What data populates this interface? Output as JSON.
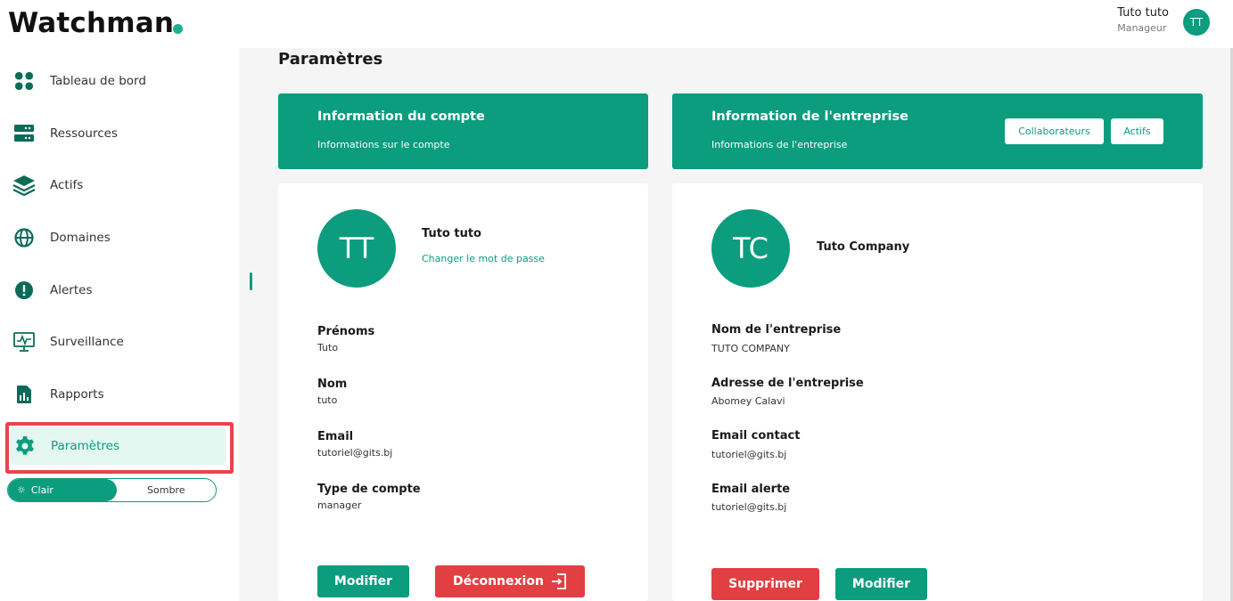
{
  "app": {
    "name": "Watchman"
  },
  "user": {
    "name": "Tuto tuto",
    "role": "Manageur",
    "initials": "TT"
  },
  "sidebar": {
    "items": [
      {
        "label": "Tableau de bord",
        "icon": "dashboard-grid-icon"
      },
      {
        "label": "Ressources",
        "icon": "server-icon"
      },
      {
        "label": "Actifs",
        "icon": "layers-icon"
      },
      {
        "label": "Domaines",
        "icon": "globe-icon"
      },
      {
        "label": "Alertes",
        "icon": "alert-icon"
      },
      {
        "label": "Surveillance",
        "icon": "monitor-icon"
      },
      {
        "label": "Rapports",
        "icon": "report-chart-icon"
      },
      {
        "label": "Paramètres",
        "icon": "gear-icon",
        "active": true
      }
    ],
    "theme": {
      "light": "Clair",
      "dark": "Sombre",
      "selected": "Clair"
    }
  },
  "page": {
    "title": "Paramètres"
  },
  "account": {
    "banner_title": "Information du compte",
    "banner_subtitle": "Informations sur le compte",
    "initials": "TT",
    "name": "Tuto tuto",
    "change_password": "Changer le mot de passe",
    "fields": [
      {
        "label": "Prénoms",
        "value": "Tuto"
      },
      {
        "label": "Nom",
        "value": "tuto"
      },
      {
        "label": "Email",
        "value": "tutoriel@gits.bj"
      },
      {
        "label": "Type de compte",
        "value": "manager"
      }
    ],
    "modify_label": "Modifier",
    "logout_label": "Déconnexion"
  },
  "company": {
    "banner_title": "Information de l'entreprise",
    "banner_subtitle": "Informations de l'entreprise",
    "collaborators_label": "Collaborateurs",
    "assets_label": "Actifs",
    "initials": "TC",
    "name": "Tuto Company",
    "fields": [
      {
        "label": "Nom de l'entreprise",
        "value": "TUTO COMPANY"
      },
      {
        "label": "Adresse de l'entreprise",
        "value": "Abomey Calavi"
      },
      {
        "label": "Email contact",
        "value": "tutoriel@gits.bj"
      },
      {
        "label": "Email alerte",
        "value": "tutoriel@gits.bj"
      }
    ],
    "delete_label": "Supprimer",
    "modify_label": "Modifier"
  },
  "colors": {
    "accent": "#0c9c7e",
    "danger": "#e23f43",
    "highlight": "#e4474a"
  }
}
